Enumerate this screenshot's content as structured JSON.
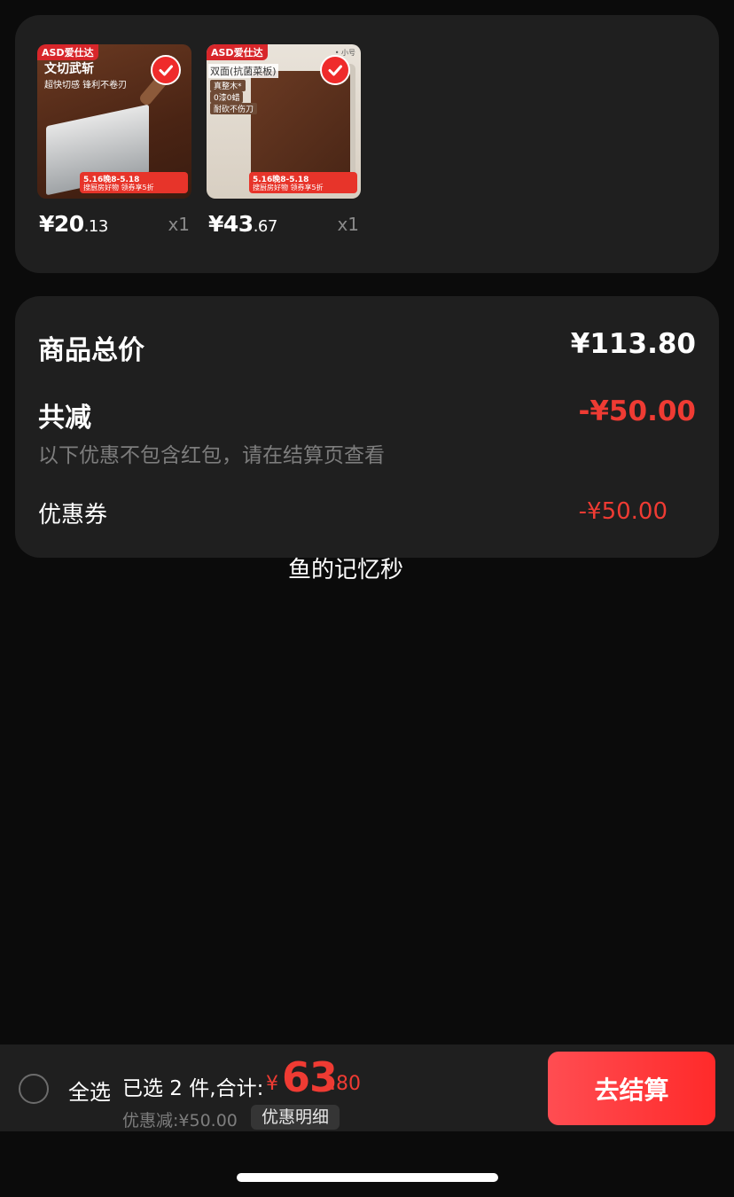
{
  "items": [
    {
      "brand": "ASD爱仕达",
      "promo_line1": "文切武斩",
      "promo_line2": "超快切感 锋利不卷刃",
      "banner_line1": "5.16晚8-5.18",
      "banner_line2": "搜厨房好物 领券享5折",
      "price_int": "¥20",
      "price_dec": ".13",
      "qty": "x1",
      "selected": true
    },
    {
      "brand": "ASD爱仕达",
      "title": "双面(抗菌菜板)",
      "tags": [
        "真整木*",
        "0漆0蜡",
        "耐砍不伤刀"
      ],
      "mini": "• 小号",
      "banner_line1": "5.16晚8-5.18",
      "banner_line2": "搜厨房好物 领券享5折",
      "price_int": "¥43",
      "price_dec": ".67",
      "qty": "x1",
      "selected": true
    }
  ],
  "summary": {
    "total_label": "商品总价",
    "total_value": "¥113.80",
    "reduce_label": "共减",
    "reduce_value": "-¥50.00",
    "note": "以下优惠不包含红包，请在结算页查看",
    "coupon_label": "优惠券",
    "coupon_value": "-¥50.00"
  },
  "watermark": "鱼的记忆秒",
  "bottom_bar": {
    "select_all": "全选",
    "selected_text": "已选 2 件,合计:",
    "total_yen": "¥",
    "total_int": "63",
    "total_dec": ".80",
    "discount_text": "优惠减:¥50.00",
    "discount_detail": "优惠明细",
    "checkout": "去结算"
  },
  "colors": {
    "accent_red": "#ef3b33",
    "card_bg": "#1f1f1f",
    "page_bg": "#0b0b0b"
  }
}
